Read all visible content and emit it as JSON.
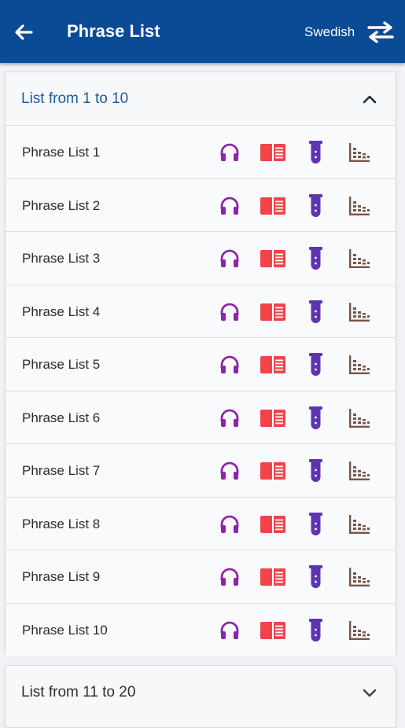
{
  "appbar": {
    "title": "Phrase List",
    "language": "Swedish",
    "back_icon": "arrow-left-icon",
    "swap_icon": "swap-arrows-icon",
    "color": "#0b4a94"
  },
  "sections": [
    {
      "label": "List from 1 to 10",
      "expanded": true,
      "items": [
        {
          "label": "Phrase List 1"
        },
        {
          "label": "Phrase List 2"
        },
        {
          "label": "Phrase List 3"
        },
        {
          "label": "Phrase List 4"
        },
        {
          "label": "Phrase List 5"
        },
        {
          "label": "Phrase List 6"
        },
        {
          "label": "Phrase List 7"
        },
        {
          "label": "Phrase List 8"
        },
        {
          "label": "Phrase List 9"
        },
        {
          "label": "Phrase List 10"
        }
      ]
    },
    {
      "label": "List from 11 to 20",
      "expanded": false,
      "items": []
    }
  ],
  "item_actions": [
    {
      "icon": "headphones-icon",
      "color": "#8e24aa"
    },
    {
      "icon": "book-icon",
      "color": "#f0444b"
    },
    {
      "icon": "test-tube-icon",
      "color": "#5e35b1"
    },
    {
      "icon": "bar-chart-icon",
      "color": "#795548"
    }
  ]
}
